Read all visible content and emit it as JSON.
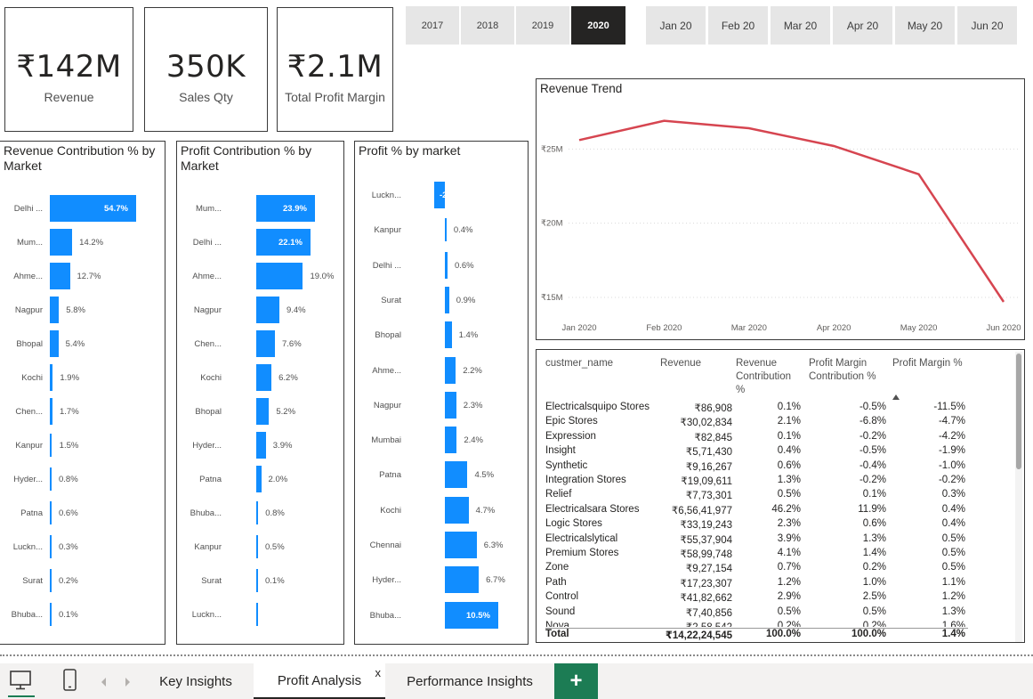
{
  "kpis": [
    {
      "value": "₹142M",
      "label": "Revenue"
    },
    {
      "value": "350K",
      "label": "Sales Qty"
    },
    {
      "value": "₹2.1M",
      "label": "Total Profit Margin"
    }
  ],
  "year_slicer": {
    "options": [
      "2017",
      "2018",
      "2019",
      "2020"
    ],
    "selected": "2020"
  },
  "month_slicer": {
    "options": [
      "Jan 20",
      "Feb 20",
      "Mar 20",
      "Apr 20",
      "May 20",
      "Jun 20"
    ]
  },
  "revenue_contribution": {
    "title": "Revenue Contribution % by Market",
    "chart_data": {
      "type": "bar",
      "categories": [
        "Delhi ...",
        "Mum...",
        "Ahme...",
        "Nagpur",
        "Bhopal",
        "Kochi",
        "Chen...",
        "Kanpur",
        "Hyder...",
        "Patna",
        "Luckn...",
        "Surat",
        "Bhuba..."
      ],
      "values": [
        54.7,
        14.2,
        12.7,
        5.8,
        5.4,
        1.9,
        1.7,
        1.5,
        0.8,
        0.6,
        0.3,
        0.2,
        0.1
      ],
      "labels": [
        "54.7%",
        "14.2%",
        "12.7%",
        "5.8%",
        "5.4%",
        "1.9%",
        "1.7%",
        "1.5%",
        "0.8%",
        "0.6%",
        "0.3%",
        "0.2%",
        "0.1%"
      ],
      "xlim": [
        0,
        54.7
      ]
    }
  },
  "profit_contribution": {
    "title": "Profit Contribution % by Market",
    "chart_data": {
      "type": "bar",
      "categories": [
        "Mum...",
        "Delhi ...",
        "Ahme...",
        "Nagpur",
        "Chen...",
        "Kochi",
        "Bhopal",
        "Hyder...",
        "Patna",
        "Bhuba...",
        "Kanpur",
        "Surat",
        "Luckn..."
      ],
      "values": [
        23.9,
        22.1,
        19.0,
        9.4,
        7.6,
        6.2,
        5.2,
        3.9,
        2.0,
        0.8,
        0.5,
        0.1,
        -0.1
      ],
      "labels": [
        "23.9%",
        "22.1%",
        "19.0%",
        "9.4%",
        "7.6%",
        "6.2%",
        "5.2%",
        "3.9%",
        "2.0%",
        "0.8%",
        "0.5%",
        "0.1%",
        ""
      ],
      "xlim": [
        0,
        23.9
      ]
    }
  },
  "profit_pct": {
    "title": "Profit % by market",
    "chart_data": {
      "type": "bar",
      "categories": [
        "Luckn...",
        "Kanpur",
        "Delhi ...",
        "Surat",
        "Bhopal",
        "Ahme...",
        "Nagpur",
        "Mumbai",
        "Patna",
        "Kochi",
        "Chennai",
        "Hyder...",
        "Bhuba..."
      ],
      "values": [
        -2.0,
        0.4,
        0.6,
        0.9,
        1.4,
        2.2,
        2.3,
        2.4,
        4.5,
        4.7,
        6.3,
        6.7,
        10.5
      ],
      "labels": [
        "-2",
        "0.4%",
        "0.6%",
        "0.9%",
        "1.4%",
        "2.2%",
        "2.3%",
        "2.4%",
        "4.5%",
        "4.7%",
        "6.3%",
        "6.7%",
        "10.5%"
      ],
      "xlim": [
        -2.0,
        10.5
      ]
    }
  },
  "revenue_trend": {
    "title": "Revenue Trend",
    "chart_data": {
      "type": "line",
      "x": [
        "Jan 2020",
        "Feb 2020",
        "Mar 2020",
        "Apr 2020",
        "May 2020",
        "Jun 2020"
      ],
      "series": [
        {
          "values": [
            25.6,
            26.9,
            26.4,
            25.2,
            23.3,
            14.7
          ]
        }
      ],
      "y_ticks": [
        "₹15M",
        "₹20M",
        "₹25M"
      ],
      "y_tick_values": [
        15,
        20,
        25
      ],
      "ylim": [
        13.5,
        28.5
      ],
      "color": "#d64550",
      "grid": true
    }
  },
  "table": {
    "headers": [
      "custmer_name",
      "Revenue",
      "Revenue Contribution %",
      "Profit Margin Contribution %",
      "Profit Margin %"
    ],
    "rows": [
      [
        "Electricalsquipo Stores",
        "₹86,908",
        "0.1%",
        "-0.5%",
        "-11.5%"
      ],
      [
        "Epic Stores",
        "₹30,02,834",
        "2.1%",
        "-6.8%",
        "-4.7%"
      ],
      [
        "Expression",
        "₹82,845",
        "0.1%",
        "-0.2%",
        "-4.2%"
      ],
      [
        "Insight",
        "₹5,71,430",
        "0.4%",
        "-0.5%",
        "-1.9%"
      ],
      [
        "Synthetic",
        "₹9,16,267",
        "0.6%",
        "-0.4%",
        "-1.0%"
      ],
      [
        "Integration Stores",
        "₹19,09,611",
        "1.3%",
        "-0.2%",
        "-0.2%"
      ],
      [
        "Relief",
        "₹7,73,301",
        "0.5%",
        "0.1%",
        "0.3%"
      ],
      [
        "Electricalsara Stores",
        "₹6,56,41,977",
        "46.2%",
        "11.9%",
        "0.4%"
      ],
      [
        "Logic Stores",
        "₹33,19,243",
        "2.3%",
        "0.6%",
        "0.4%"
      ],
      [
        "Electricalslytical",
        "₹55,37,904",
        "3.9%",
        "1.3%",
        "0.5%"
      ],
      [
        "Premium Stores",
        "₹58,99,748",
        "4.1%",
        "1.4%",
        "0.5%"
      ],
      [
        "Zone",
        "₹9,27,154",
        "0.7%",
        "0.2%",
        "0.5%"
      ],
      [
        "Path",
        "₹17,23,307",
        "1.2%",
        "1.0%",
        "1.1%"
      ],
      [
        "Control",
        "₹41,82,662",
        "2.9%",
        "2.5%",
        "1.2%"
      ],
      [
        "Sound",
        "₹7,40,856",
        "0.5%",
        "0.5%",
        "1.3%"
      ],
      [
        "Nova",
        "₹2,58,542",
        "0.2%",
        "0.2%",
        "1.6%"
      ]
    ],
    "total": [
      "Total",
      "₹14,22,24,545",
      "100.0%",
      "100.0%",
      "1.4%"
    ]
  },
  "tabs": {
    "items": [
      "Key Insights",
      "Profit Analysis",
      "Performance Insights"
    ],
    "active": "Profit Analysis",
    "close_glyph": "x",
    "add_glyph": "+"
  },
  "colors": {
    "accent": "#118dff",
    "trend_line": "#d64550",
    "add_button": "#1c7c54"
  }
}
